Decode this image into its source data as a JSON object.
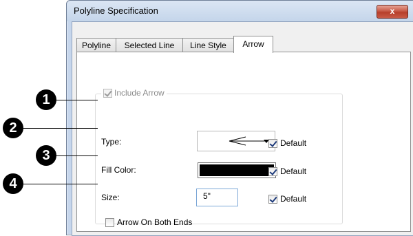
{
  "window": {
    "title": "Polyline Specification",
    "close_label": "x"
  },
  "tabs": [
    {
      "label": "Polyline",
      "active": false
    },
    {
      "label": "Selected Line",
      "active": false
    },
    {
      "label": "Line Style",
      "active": false
    },
    {
      "label": "Arrow",
      "active": true
    }
  ],
  "arrow_panel": {
    "include_arrow": {
      "label": "Include Arrow",
      "checked": true,
      "enabled": false
    },
    "type": {
      "label": "Type:",
      "default_label": "Default",
      "default_checked": true,
      "value_icon": "arrow-left-icon"
    },
    "fill_color": {
      "label": "Fill Color:",
      "color": "#000000",
      "default_label": "Default",
      "default_checked": true
    },
    "size": {
      "label": "Size:",
      "value": "5\"",
      "default_label": "Default",
      "default_checked": true
    },
    "both_ends": {
      "label": "Arrow On Both Ends",
      "checked": false
    }
  },
  "callouts": [
    "1",
    "2",
    "3",
    "4"
  ]
}
